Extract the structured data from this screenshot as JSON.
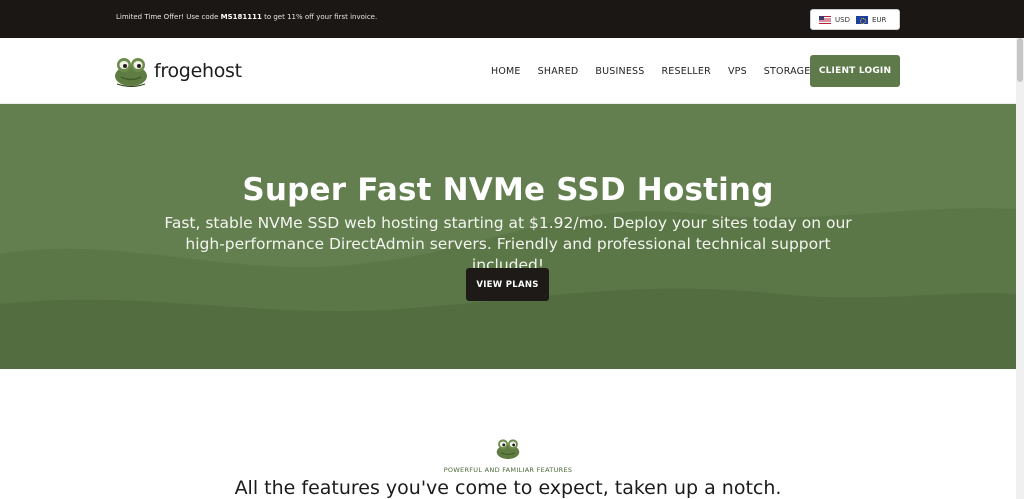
{
  "topbar": {
    "promo_prefix": "Limited Time Offer! Use code ",
    "promo_code": "MS181111",
    "promo_suffix": " to get 11% off your first invoice.",
    "currencies": [
      {
        "label": "USD",
        "flag": "us-flag-icon"
      },
      {
        "label": "EUR",
        "flag": "eu-flag-icon"
      }
    ]
  },
  "header": {
    "logo_text": "frogehost",
    "nav": [
      "HOME",
      "SHARED",
      "BUSINESS",
      "RESELLER",
      "VPS",
      "STORAGE"
    ],
    "login_label": "CLIENT LOGIN"
  },
  "hero": {
    "title": "Super Fast NVMe SSD Hosting",
    "subtitle": "Fast, stable NVMe SSD web hosting starting at $1.92/mo. Deploy your sites today on our high-performance DirectAdmin servers. Friendly and professional technical support included!",
    "button_label": "VIEW PLANS"
  },
  "features": {
    "eyebrow": "POWERFUL AND FAMILIAR FEATURES",
    "heading": "All the features you've come to expect, taken up a notch."
  },
  "colors": {
    "brand_green": "#5e7a4b",
    "hero_green": "#637f4f",
    "dark": "#1a1714"
  }
}
